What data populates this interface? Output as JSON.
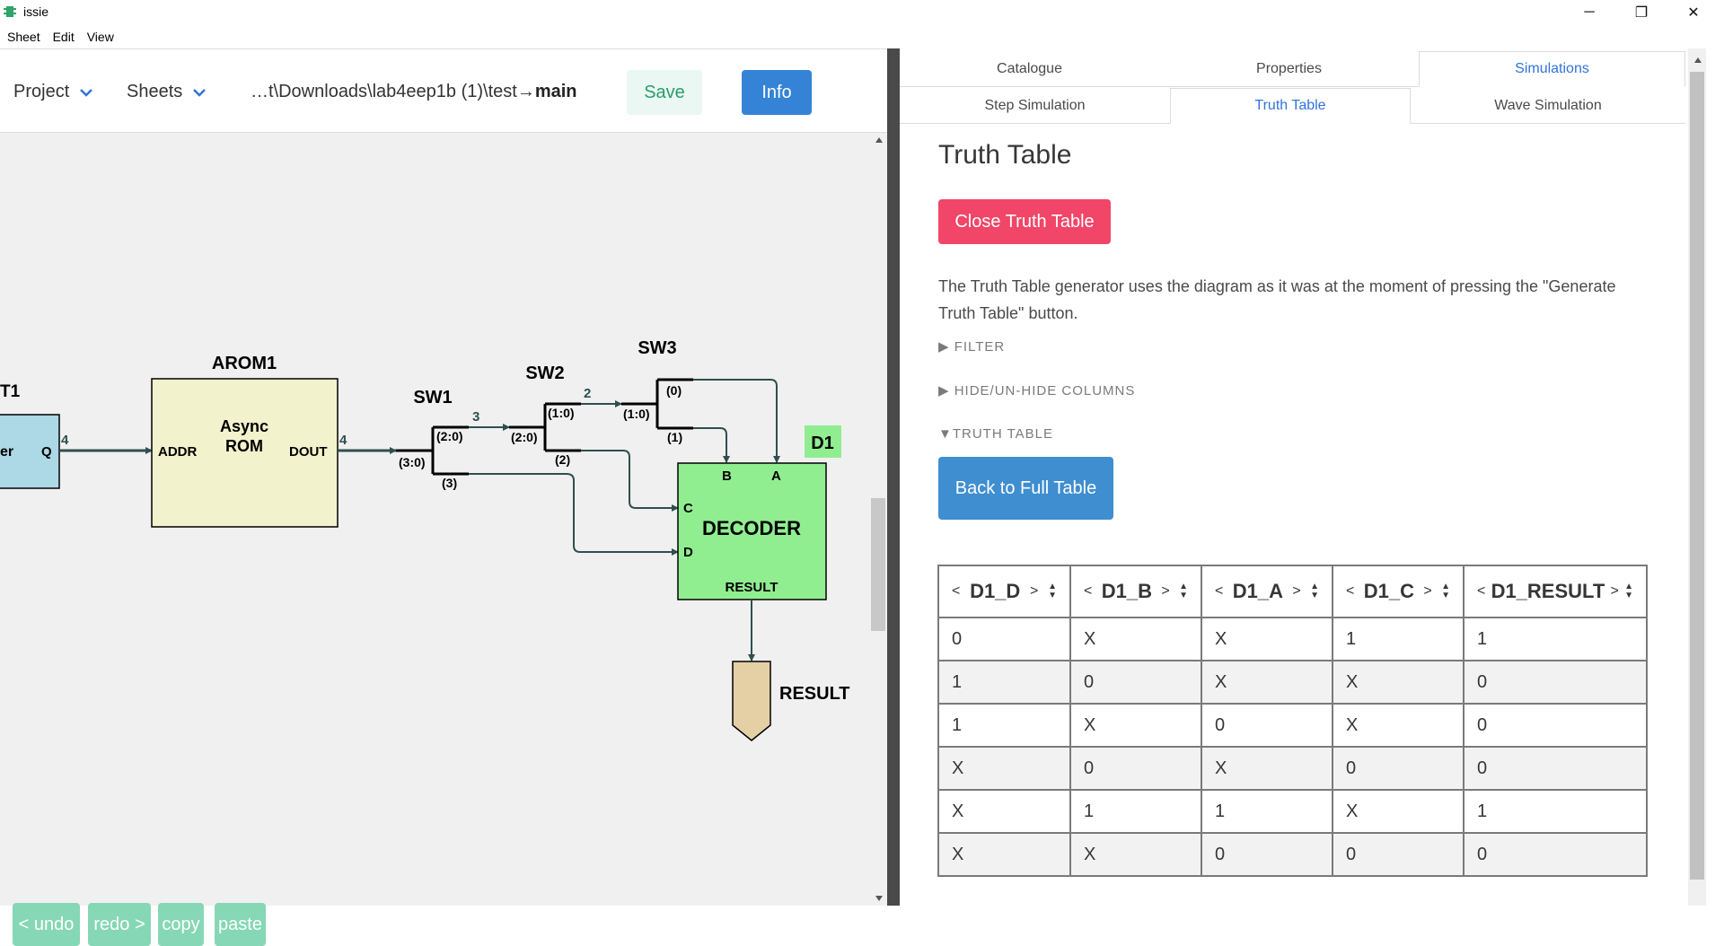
{
  "window": {
    "title": "issie",
    "minimize": "─",
    "maximize": "❐",
    "close": "✕"
  },
  "menu": [
    "Sheet",
    "Edit",
    "View"
  ],
  "toolbar": {
    "project_label": "Project",
    "sheets_label": "Sheets",
    "path_prefix": "…t\\Downloads\\lab4eep1b (1)\\test→",
    "path_sheet": "main",
    "save_label": "Save",
    "info_label": "Info"
  },
  "schematic": {
    "components": {
      "input_label": "T1",
      "input_inner_left": "er",
      "input_port": "Q",
      "rom_title": "AROM1",
      "rom_text_1": "Async",
      "rom_text_2": "ROM",
      "rom_addr": "ADDR",
      "rom_dout": "DOUT",
      "sw1": "SW1",
      "sw2": "SW2",
      "sw3": "SW3",
      "decoder_title": "D1",
      "decoder_text": "DECODER",
      "decoder_b": "B",
      "decoder_a": "A",
      "decoder_c": "C",
      "decoder_d": "D",
      "decoder_result": "RESULT",
      "output_label": "RESULT"
    },
    "wire_labels": {
      "w_in": "4",
      "w_rom": "4",
      "sw1_in": "(3:0)",
      "sw1_out0": "(2:0)",
      "sw1_out1": "(3)",
      "sw1_width": "3",
      "sw2_in": "(2:0)",
      "sw2_out0": "(1:0)",
      "sw2_out1": "(2)",
      "sw2_width": "2",
      "sw3_in": "(1:0)",
      "sw3_out0": "(0)",
      "sw3_out1": "(1)"
    }
  },
  "edit_buttons": {
    "undo": "< undo",
    "redo": "redo >",
    "copy": "copy",
    "paste": "paste"
  },
  "tabs": {
    "top": [
      "Catalogue",
      "Properties",
      "Simulations"
    ],
    "sub": [
      "Step Simulation",
      "Truth Table",
      "Wave Simulation"
    ]
  },
  "truth_table_panel": {
    "heading": "Truth Table",
    "close_label": "Close Truth Table",
    "description": "The Truth Table generator uses the diagram as it was at the moment of pressing the \"Generate Truth Table\" button.",
    "filter_label": "▶ FILTER",
    "hide_label": "▶ HIDE/UN-HIDE COLUMNS",
    "table_label": "▼TRUTH TABLE",
    "back_label": "Back to Full Table"
  },
  "truth_table": {
    "headers": [
      "D1_D",
      "D1_B",
      "D1_A",
      "D1_C",
      "D1_RESULT"
    ],
    "rows": [
      [
        "0",
        "X",
        "X",
        "1",
        "1"
      ],
      [
        "1",
        "0",
        "X",
        "X",
        "0"
      ],
      [
        "1",
        "X",
        "0",
        "X",
        "0"
      ],
      [
        "X",
        "0",
        "X",
        "0",
        "0"
      ],
      [
        "X",
        "1",
        "1",
        "X",
        "1"
      ],
      [
        "X",
        "X",
        "0",
        "0",
        "0"
      ]
    ]
  },
  "colors": {
    "input_fill": "#add8e6",
    "rom_fill": "#f2f2cc",
    "decoder_fill": "#90ee90",
    "output_fill": "#e5d0a6",
    "wire": "#2f4f4f",
    "accent_blue": "#3273dc",
    "close_red": "#f14668"
  }
}
